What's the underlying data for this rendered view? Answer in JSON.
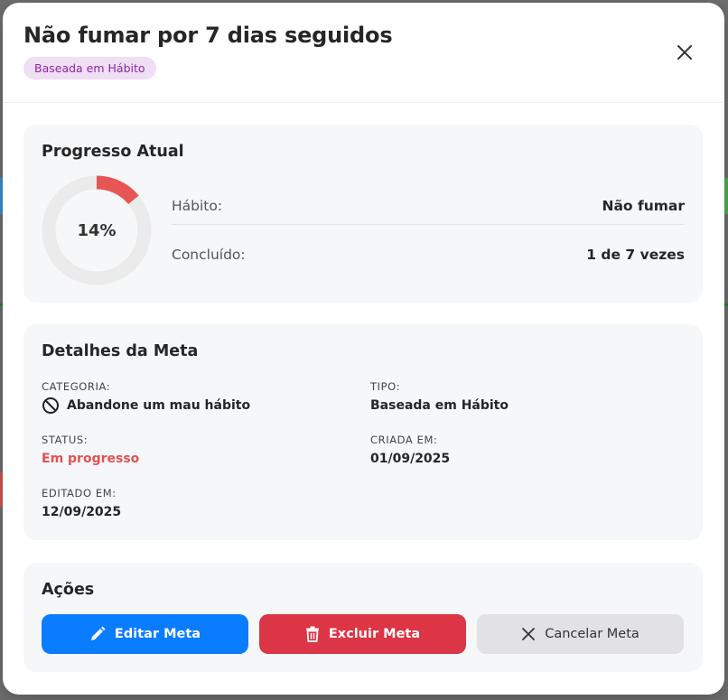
{
  "modal": {
    "title": "Não fumar por 7 dias seguidos",
    "type_badge": "Baseada em Hábito",
    "close_icon": "close-icon"
  },
  "progress": {
    "title": "Progresso Atual",
    "percent": 14,
    "percent_label": "14%",
    "ring_color": "#e85555",
    "habit_label": "Hábito:",
    "habit_value": "Não fumar",
    "done_label": "Concluído:",
    "done_value": "1 de 7 vezes"
  },
  "details": {
    "title": "Detalhes da Meta",
    "category_label": "CATEGORIA:",
    "category_value": "Abandone um mau hábito",
    "category_icon": "ban-icon",
    "type_label": "TIPO:",
    "type_value": "Baseada em Hábito",
    "status_label": "STATUS:",
    "status_value": "Em progresso",
    "status_color": "#e05252",
    "created_label": "CRIADA EM:",
    "created_value": "01/09/2025",
    "edited_label": "EDITADO EM:",
    "edited_value": "12/09/2025"
  },
  "actions": {
    "title": "Ações",
    "edit_label": "Editar Meta",
    "edit_icon": "pencil-icon",
    "delete_label": "Excluir Meta",
    "delete_icon": "trash-icon",
    "cancel_label": "Cancelar Meta",
    "cancel_icon": "x-icon"
  }
}
